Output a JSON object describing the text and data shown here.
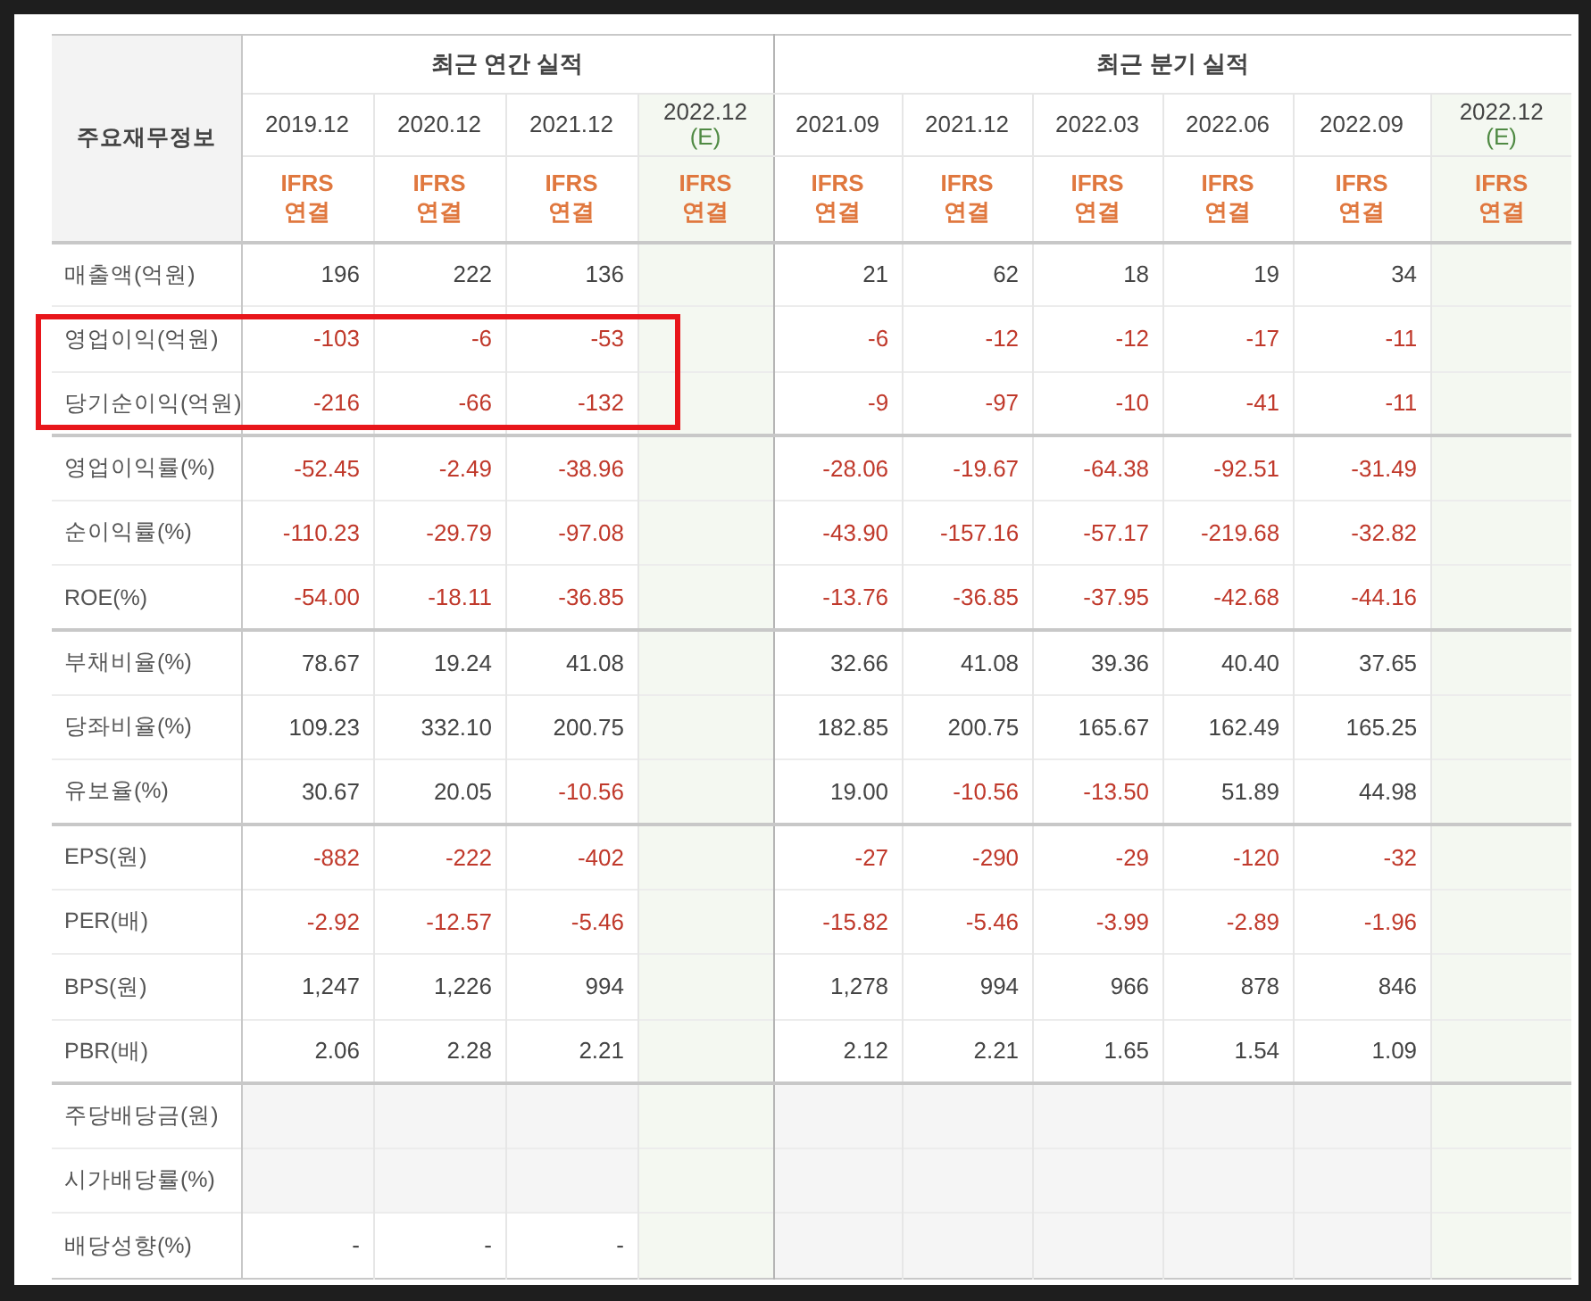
{
  "table": {
    "corner_label": "주요재무정보",
    "groups": [
      {
        "label": "최근 연간 실적",
        "periods": [
          {
            "label": "2019.12",
            "estimate": false,
            "standard": "IFRS",
            "basis": "연결"
          },
          {
            "label": "2020.12",
            "estimate": false,
            "standard": "IFRS",
            "basis": "연결"
          },
          {
            "label": "2021.12",
            "estimate": false,
            "standard": "IFRS",
            "basis": "연결"
          },
          {
            "label": "2022.12",
            "suffix": "(E)",
            "estimate": true,
            "standard": "IFRS",
            "basis": "연결"
          }
        ]
      },
      {
        "label": "최근 분기 실적",
        "periods": [
          {
            "label": "2021.09",
            "estimate": false,
            "standard": "IFRS",
            "basis": "연결"
          },
          {
            "label": "2021.12",
            "estimate": false,
            "standard": "IFRS",
            "basis": "연결"
          },
          {
            "label": "2022.03",
            "estimate": false,
            "standard": "IFRS",
            "basis": "연결"
          },
          {
            "label": "2022.06",
            "estimate": false,
            "standard": "IFRS",
            "basis": "연결"
          },
          {
            "label": "2022.09",
            "estimate": false,
            "standard": "IFRS",
            "basis": "연결"
          },
          {
            "label": "2022.12",
            "suffix": "(E)",
            "estimate": true,
            "standard": "IFRS",
            "basis": "연결"
          }
        ]
      }
    ],
    "rows": [
      {
        "label": "매출액(억원)",
        "divider_above": true,
        "highlighted": false,
        "cells": [
          {
            "text": "196",
            "negative": false
          },
          {
            "text": "222",
            "negative": false
          },
          {
            "text": "136",
            "negative": false
          },
          null,
          {
            "text": "21",
            "negative": false
          },
          {
            "text": "62",
            "negative": false
          },
          {
            "text": "18",
            "negative": false
          },
          {
            "text": "19",
            "negative": false
          },
          {
            "text": "34",
            "negative": false
          },
          null
        ]
      },
      {
        "label": "영업이익(억원)",
        "divider_above": false,
        "highlighted": true,
        "cells": [
          {
            "text": "-103",
            "negative": true
          },
          {
            "text": "-6",
            "negative": true
          },
          {
            "text": "-53",
            "negative": true
          },
          null,
          {
            "text": "-6",
            "negative": true
          },
          {
            "text": "-12",
            "negative": true
          },
          {
            "text": "-12",
            "negative": true
          },
          {
            "text": "-17",
            "negative": true
          },
          {
            "text": "-11",
            "negative": true
          },
          null
        ]
      },
      {
        "label": "당기순이익(억원)",
        "divider_above": false,
        "highlighted": true,
        "cells": [
          {
            "text": "-216",
            "negative": true
          },
          {
            "text": "-66",
            "negative": true
          },
          {
            "text": "-132",
            "negative": true
          },
          null,
          {
            "text": "-9",
            "negative": true
          },
          {
            "text": "-97",
            "negative": true
          },
          {
            "text": "-10",
            "negative": true
          },
          {
            "text": "-41",
            "negative": true
          },
          {
            "text": "-11",
            "negative": true
          },
          null
        ]
      },
      {
        "label": "영업이익률(%)",
        "divider_above": true,
        "highlighted": false,
        "cells": [
          {
            "text": "-52.45",
            "negative": true
          },
          {
            "text": "-2.49",
            "negative": true
          },
          {
            "text": "-38.96",
            "negative": true
          },
          null,
          {
            "text": "-28.06",
            "negative": true
          },
          {
            "text": "-19.67",
            "negative": true
          },
          {
            "text": "-64.38",
            "negative": true
          },
          {
            "text": "-92.51",
            "negative": true
          },
          {
            "text": "-31.49",
            "negative": true
          },
          null
        ]
      },
      {
        "label": "순이익률(%)",
        "divider_above": false,
        "highlighted": false,
        "cells": [
          {
            "text": "-110.23",
            "negative": true
          },
          {
            "text": "-29.79",
            "negative": true
          },
          {
            "text": "-97.08",
            "negative": true
          },
          null,
          {
            "text": "-43.90",
            "negative": true
          },
          {
            "text": "-157.16",
            "negative": true
          },
          {
            "text": "-57.17",
            "negative": true
          },
          {
            "text": "-219.68",
            "negative": true
          },
          {
            "text": "-32.82",
            "negative": true
          },
          null
        ]
      },
      {
        "label": "ROE(%)",
        "divider_above": false,
        "highlighted": false,
        "cells": [
          {
            "text": "-54.00",
            "negative": true
          },
          {
            "text": "-18.11",
            "negative": true
          },
          {
            "text": "-36.85",
            "negative": true
          },
          null,
          {
            "text": "-13.76",
            "negative": true
          },
          {
            "text": "-36.85",
            "negative": true
          },
          {
            "text": "-37.95",
            "negative": true
          },
          {
            "text": "-42.68",
            "negative": true
          },
          {
            "text": "-44.16",
            "negative": true
          },
          null
        ]
      },
      {
        "label": "부채비율(%)",
        "divider_above": true,
        "highlighted": false,
        "cells": [
          {
            "text": "78.67",
            "negative": false
          },
          {
            "text": "19.24",
            "negative": false
          },
          {
            "text": "41.08",
            "negative": false
          },
          null,
          {
            "text": "32.66",
            "negative": false
          },
          {
            "text": "41.08",
            "negative": false
          },
          {
            "text": "39.36",
            "negative": false
          },
          {
            "text": "40.40",
            "negative": false
          },
          {
            "text": "37.65",
            "negative": false
          },
          null
        ]
      },
      {
        "label": "당좌비율(%)",
        "divider_above": false,
        "highlighted": false,
        "cells": [
          {
            "text": "109.23",
            "negative": false
          },
          {
            "text": "332.10",
            "negative": false
          },
          {
            "text": "200.75",
            "negative": false
          },
          null,
          {
            "text": "182.85",
            "negative": false
          },
          {
            "text": "200.75",
            "negative": false
          },
          {
            "text": "165.67",
            "negative": false
          },
          {
            "text": "162.49",
            "negative": false
          },
          {
            "text": "165.25",
            "negative": false
          },
          null
        ]
      },
      {
        "label": "유보율(%)",
        "divider_above": false,
        "highlighted": false,
        "cells": [
          {
            "text": "30.67",
            "negative": false
          },
          {
            "text": "20.05",
            "negative": false
          },
          {
            "text": "-10.56",
            "negative": true
          },
          null,
          {
            "text": "19.00",
            "negative": false
          },
          {
            "text": "-10.56",
            "negative": true
          },
          {
            "text": "-13.50",
            "negative": true
          },
          {
            "text": "51.89",
            "negative": false
          },
          {
            "text": "44.98",
            "negative": false
          },
          null
        ]
      },
      {
        "label": "EPS(원)",
        "divider_above": true,
        "highlighted": false,
        "cells": [
          {
            "text": "-882",
            "negative": true
          },
          {
            "text": "-222",
            "negative": true
          },
          {
            "text": "-402",
            "negative": true
          },
          null,
          {
            "text": "-27",
            "negative": true
          },
          {
            "text": "-290",
            "negative": true
          },
          {
            "text": "-29",
            "negative": true
          },
          {
            "text": "-120",
            "negative": true
          },
          {
            "text": "-32",
            "negative": true
          },
          null
        ]
      },
      {
        "label": "PER(배)",
        "divider_above": false,
        "highlighted": false,
        "cells": [
          {
            "text": "-2.92",
            "negative": true
          },
          {
            "text": "-12.57",
            "negative": true
          },
          {
            "text": "-5.46",
            "negative": true
          },
          null,
          {
            "text": "-15.82",
            "negative": true
          },
          {
            "text": "-5.46",
            "negative": true
          },
          {
            "text": "-3.99",
            "negative": true
          },
          {
            "text": "-2.89",
            "negative": true
          },
          {
            "text": "-1.96",
            "negative": true
          },
          null
        ]
      },
      {
        "label": "BPS(원)",
        "divider_above": false,
        "highlighted": false,
        "cells": [
          {
            "text": "1,247",
            "negative": false
          },
          {
            "text": "1,226",
            "negative": false
          },
          {
            "text": "994",
            "negative": false
          },
          null,
          {
            "text": "1,278",
            "negative": false
          },
          {
            "text": "994",
            "negative": false
          },
          {
            "text": "966",
            "negative": false
          },
          {
            "text": "878",
            "negative": false
          },
          {
            "text": "846",
            "negative": false
          },
          null
        ]
      },
      {
        "label": "PBR(배)",
        "divider_above": false,
        "highlighted": false,
        "cells": [
          {
            "text": "2.06",
            "negative": false
          },
          {
            "text": "2.28",
            "negative": false
          },
          {
            "text": "2.21",
            "negative": false
          },
          null,
          {
            "text": "2.12",
            "negative": false
          },
          {
            "text": "2.21",
            "negative": false
          },
          {
            "text": "1.65",
            "negative": false
          },
          {
            "text": "1.54",
            "negative": false
          },
          {
            "text": "1.09",
            "negative": false
          },
          null
        ]
      },
      {
        "label": "주당배당금(원)",
        "divider_above": true,
        "highlighted": false,
        "cells": [
          null,
          null,
          null,
          null,
          null,
          null,
          null,
          null,
          null,
          null
        ]
      },
      {
        "label": "시가배당률(%)",
        "divider_above": false,
        "highlighted": false,
        "cells": [
          null,
          null,
          null,
          null,
          null,
          null,
          null,
          null,
          null,
          null
        ]
      },
      {
        "label": "배당성향(%)",
        "divider_above": false,
        "highlighted": false,
        "cells": [
          {
            "text": "-",
            "negative": false
          },
          {
            "text": "-",
            "negative": false
          },
          {
            "text": "-",
            "negative": false
          },
          null,
          null,
          null,
          null,
          null,
          null,
          null
        ]
      }
    ]
  }
}
